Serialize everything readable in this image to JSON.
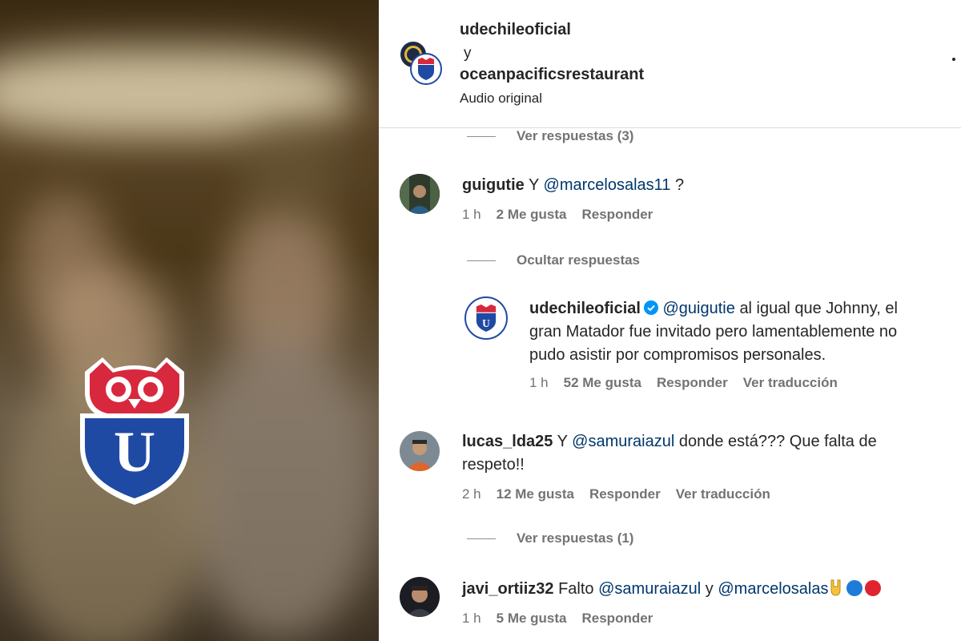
{
  "header": {
    "user1": "udechileoficial",
    "connector": "y",
    "user2": "oceanpacificsrestaurant",
    "audio": "Audio original"
  },
  "thread": {
    "view_replies_1": "Ver respuestas (3)",
    "hide_replies": "Ocultar respuestas",
    "view_replies_2": "Ver respuestas (1)"
  },
  "comments": [
    {
      "username": "guigutie",
      "text_prefix": "Y",
      "mention": "@marcelosalas11",
      "text_suffix": "?",
      "time": "1 h",
      "likes": "2 Me gusta",
      "reply": "Responder"
    },
    {
      "username": "udechileoficial",
      "mention": "@guigutie",
      "line1_rest": "al igual que Johnny, el",
      "line2": "gran Matador fue invitado pero lamentablemente no",
      "line3": "pudo asistir por compromisos personales.",
      "time": "1 h",
      "likes": "52 Me gusta",
      "reply": "Responder",
      "translate": "Ver traducción"
    },
    {
      "username": "lucas_lda25",
      "text_prefix": "Y",
      "mention": "@samuraiazul",
      "line1_rest": "donde está??? Que falta de",
      "line2": "respeto!!",
      "time": "2 h",
      "likes": "12 Me gusta",
      "reply": "Responder",
      "translate": "Ver traducción"
    },
    {
      "username": "javi_ortiiz32",
      "text_prefix": "Falto",
      "mention1": "@samuraiazul",
      "connector": "y",
      "mention2": "@marcelosalas",
      "time": "1 h",
      "likes": "5 Me gusta",
      "reply": "Responder"
    }
  ],
  "crest": {
    "letter": "U"
  },
  "colors": {
    "mention": "#00376b",
    "secondary_text": "#737373",
    "verified": "#0095f6",
    "crest_blue": "#1f4aa3",
    "crest_red": "#d8283d"
  },
  "icons": [
    "more-icon",
    "verified-icon",
    "rock-hand-emoji",
    "blue-circle-emoji",
    "red-circle-emoji"
  ]
}
